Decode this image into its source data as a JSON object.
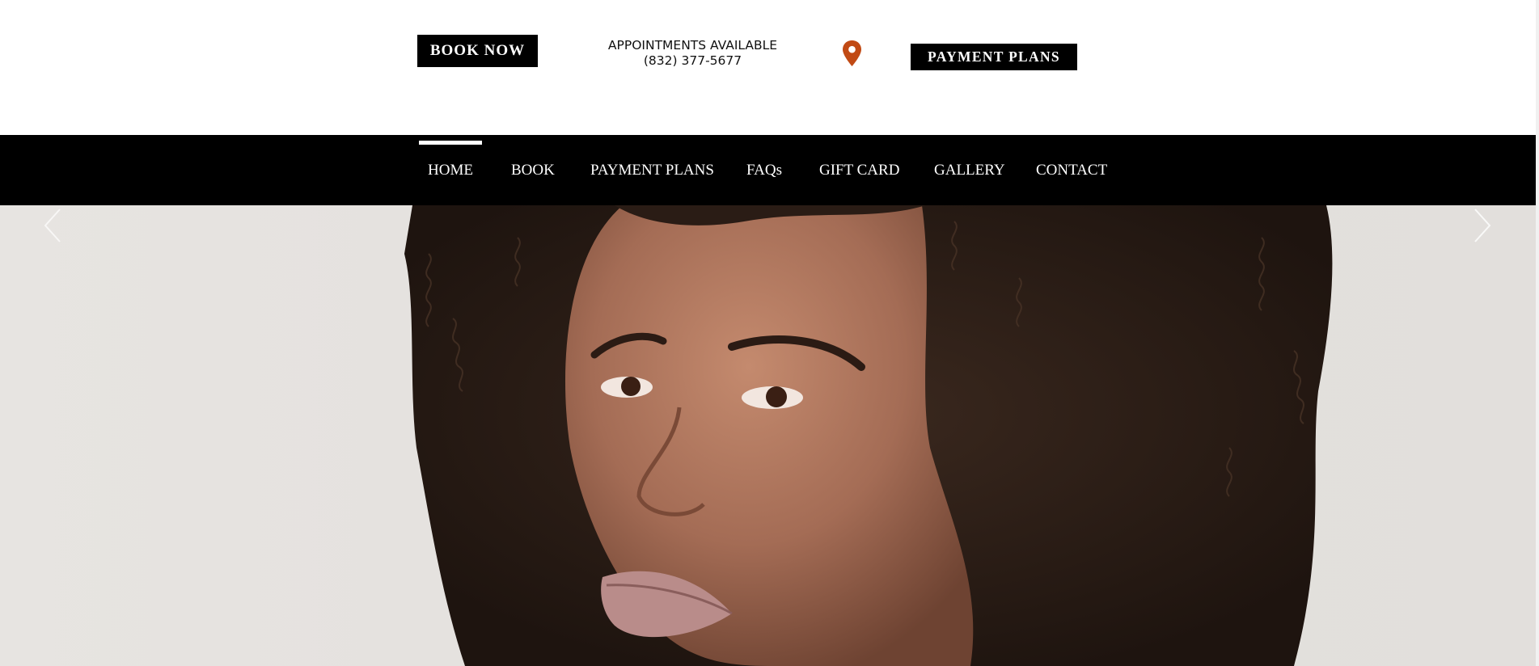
{
  "header": {
    "book_now_label": "BOOK NOW",
    "appointments_line1": "APPOINTMENTS AVAILABLE",
    "appointments_line2": "(832) 377-5677",
    "location_icon": "map-pin-icon",
    "payment_plans_label": "PAYMENT PLANS"
  },
  "nav": {
    "items": [
      {
        "label": "HOME",
        "active": true
      },
      {
        "label": "BOOK"
      },
      {
        "label": "PAYMENT PLANS"
      },
      {
        "label": "FAQs"
      },
      {
        "label": "GIFT CARD"
      },
      {
        "label": "GALLERY"
      },
      {
        "label": "CONTACT"
      }
    ]
  },
  "hero": {
    "prev_icon": "chevron-left-icon",
    "next_icon": "chevron-right-icon"
  },
  "colors": {
    "black": "#000000",
    "white": "#ffffff",
    "pin": "#c14a14",
    "hero_background": "#e4e1de",
    "hair": "#2e2018",
    "skin": "#a7705a"
  }
}
